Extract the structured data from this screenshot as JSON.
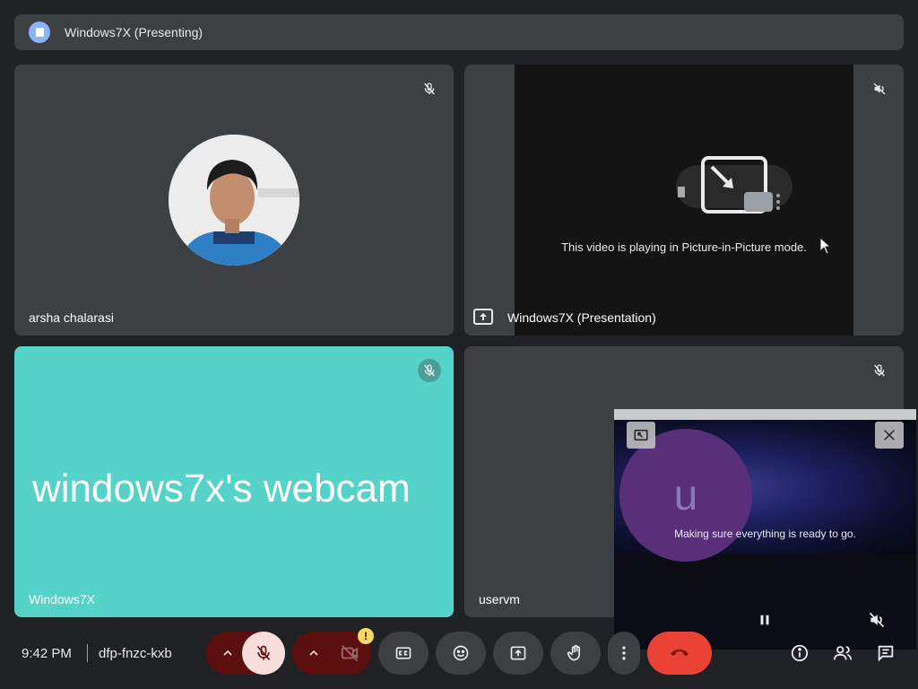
{
  "topbar": {
    "title": "Windows7X (Presenting)"
  },
  "tiles": [
    {
      "name": "arsha chalarasi",
      "muted": true
    },
    {
      "name": "Windows7X (Presentation)",
      "message": "This video is playing in Picture-in-Picture mode.",
      "muted": true
    },
    {
      "name": "Windows7X",
      "webcam_text": "windows7x's webcam",
      "muted": true
    },
    {
      "name": "uservm",
      "muted": true
    }
  ],
  "pip": {
    "avatar_letter": "u",
    "status": "Making sure everything is ready to go."
  },
  "bottombar": {
    "time": "9:42 PM",
    "meeting_code": "dfp-fnzc-kxb",
    "warning_badge": "!"
  },
  "colors": {
    "background": "#202124",
    "tile": "#3c4043",
    "webcam_tile": "#55d3c8",
    "end_call": "#ea4335",
    "mic_muted_bg": "#f9dedc",
    "device_group_bg": "#5c0f0f",
    "warning": "#fdd663",
    "presenting_badge": "#8ab4f8"
  },
  "icons": {
    "topbar": "presenting-icon",
    "tiles": "mic-off-icon",
    "controls": [
      "caret-up-icon",
      "mic-off-icon",
      "caret-up-icon",
      "camera-off-icon",
      "closed-captions-icon",
      "emoji-icon",
      "present-screen-icon",
      "raise-hand-icon",
      "more-options-icon",
      "end-call-icon",
      "info-icon",
      "people-icon",
      "chat-icon"
    ]
  }
}
